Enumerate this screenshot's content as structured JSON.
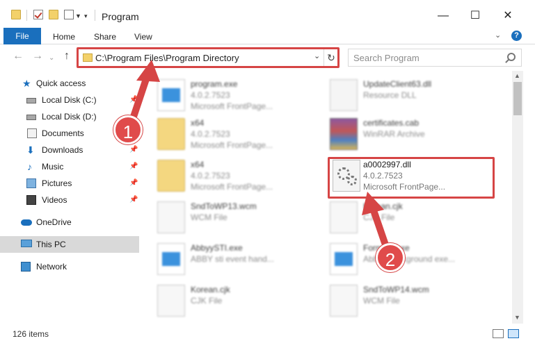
{
  "titlebar": {
    "title": "Program",
    "minimize": "—",
    "maximize": "☐",
    "close": "✕"
  },
  "ribbon": {
    "file": "File",
    "home": "Home",
    "share": "Share",
    "view": "View",
    "help": "?"
  },
  "nav": {
    "back": "←",
    "forward": "→",
    "up": "↑",
    "address": "C:\\Program Files\\Program Directory",
    "search_placeholder": "Search Program"
  },
  "sidebar": {
    "items": [
      {
        "label": "Quick access"
      },
      {
        "label": "Local Disk (C:)"
      },
      {
        "label": "Local Disk (D:)"
      },
      {
        "label": "Documents"
      },
      {
        "label": "Downloads"
      },
      {
        "label": "Music"
      },
      {
        "label": "Pictures"
      },
      {
        "label": "Videos"
      },
      {
        "label": "OneDrive"
      },
      {
        "label": "This PC"
      },
      {
        "label": "Network"
      }
    ]
  },
  "files": [
    {
      "name": "program.exe",
      "line2": "4.0.2.7523",
      "line3": "Microsoft FrontPage..."
    },
    {
      "name": "UpdateClient63.dll",
      "line2": "Resource DLL",
      "line3": ""
    },
    {
      "name": "x64",
      "line2": "4.0.2.7523",
      "line3": "Microsoft FrontPage..."
    },
    {
      "name": "certificates.cab",
      "line2": "WinRAR Archive",
      "line3": ""
    },
    {
      "name": "x64",
      "line2": "4.0.2.7523",
      "line3": "Microsoft FrontPage..."
    },
    {
      "name": "SndToWP13.wcm",
      "line2": "WCM File",
      "line3": ""
    },
    {
      "name": "Korean.cjk",
      "line2": "CJK File",
      "line3": ""
    },
    {
      "name": "AbbyySTI.exe",
      "line2": "ABBY sti event hand...",
      "line3": ""
    },
    {
      "name": "Formats.exe",
      "line2": "Abbyy background exe...",
      "line3": ""
    },
    {
      "name": "Korean.cjk",
      "line2": "CJK File",
      "line3": ""
    },
    {
      "name": "SndToWP14.wcm",
      "line2": "WCM File",
      "line3": ""
    }
  ],
  "highlighted_file": {
    "name": "a0002997.dll",
    "line2": "4.0.2.7523",
    "line3": "Microsoft FrontPage..."
  },
  "status": {
    "items": "126 items"
  },
  "annotations": {
    "step1": "1",
    "step2": "2",
    "color": "#d64545"
  }
}
